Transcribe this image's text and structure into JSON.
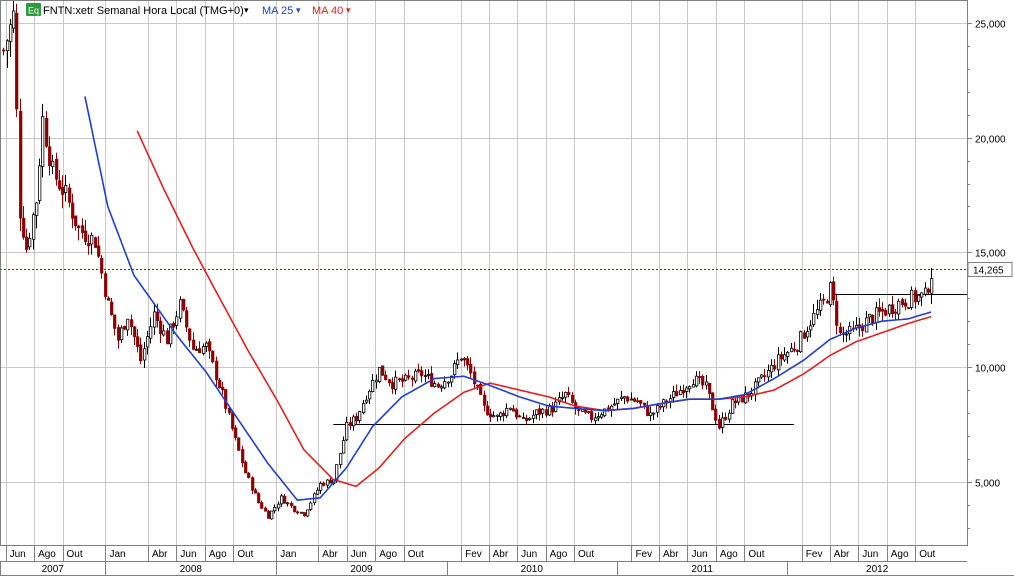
{
  "header": {
    "eq_badge": "Eq",
    "symbol_label": "FNTN:xetr Semanal Hora Local (TMG+0)",
    "ma25_label": "MA 25",
    "ma40_label": "MA 40",
    "dropdown_glyph": "▾"
  },
  "colors": {
    "price_up": "#000000",
    "price_down": "#8b0000",
    "ma25": "#1f3fd1",
    "ma40": "#e02020",
    "grid": "#c8c8c8",
    "highlight_line": "#cc0000",
    "eq_badge_bg": "#2e9b3a"
  },
  "chart_data": {
    "type": "candlestick",
    "title": "FNTN:xetr Semanal Hora Local (TMG+0)",
    "y_axis": {
      "side": "right",
      "ticks": [
        5000,
        10000,
        15000,
        20000,
        25000
      ],
      "tick_labels": [
        "5,000",
        "10,000",
        "15,000",
        "20,000",
        "25,000"
      ],
      "ylim": [
        2200,
        26000
      ]
    },
    "x_axis": {
      "xlim": [
        "2007-05-20",
        "2013-01-20"
      ],
      "month_ticks": [
        {
          "date": "2007-06-01",
          "label": "Jun"
        },
        {
          "date": "2007-08-01",
          "label": "Ago"
        },
        {
          "date": "2007-10-01",
          "label": "Out"
        },
        {
          "date": "2008-01-01",
          "label": "Jan"
        },
        {
          "date": "2008-04-01",
          "label": "Abr"
        },
        {
          "date": "2008-06-01",
          "label": "Jun"
        },
        {
          "date": "2008-08-01",
          "label": "Ago"
        },
        {
          "date": "2008-10-01",
          "label": "Out"
        },
        {
          "date": "2009-01-01",
          "label": "Jan"
        },
        {
          "date": "2009-04-01",
          "label": "Abr"
        },
        {
          "date": "2009-06-01",
          "label": "Jun"
        },
        {
          "date": "2009-08-01",
          "label": "Ago"
        },
        {
          "date": "2009-10-01",
          "label": "Out"
        },
        {
          "date": "2010-02-01",
          "label": "Fev"
        },
        {
          "date": "2010-04-01",
          "label": "Abr"
        },
        {
          "date": "2010-06-01",
          "label": "Jun"
        },
        {
          "date": "2010-08-01",
          "label": "Ago"
        },
        {
          "date": "2010-10-01",
          "label": "Out"
        },
        {
          "date": "2011-02-01",
          "label": "Fev"
        },
        {
          "date": "2011-04-01",
          "label": "Abr"
        },
        {
          "date": "2011-06-01",
          "label": "Jun"
        },
        {
          "date": "2011-08-01",
          "label": "Ago"
        },
        {
          "date": "2011-10-01",
          "label": "Out"
        },
        {
          "date": "2012-02-01",
          "label": "Fev"
        },
        {
          "date": "2012-04-01",
          "label": "Abr"
        },
        {
          "date": "2012-06-01",
          "label": "Jun"
        },
        {
          "date": "2012-08-01",
          "label": "Ago"
        },
        {
          "date": "2012-10-01",
          "label": "Out"
        }
      ],
      "year_labels": [
        {
          "label": "2007",
          "start": "2007-05-20",
          "end": "2008-01-01"
        },
        {
          "label": "2008",
          "start": "2008-01-01",
          "end": "2009-01-01"
        },
        {
          "label": "2009",
          "start": "2009-01-01",
          "end": "2010-01-01"
        },
        {
          "label": "2010",
          "start": "2010-01-01",
          "end": "2011-01-01"
        },
        {
          "label": "2011",
          "start": "2011-01-01",
          "end": "2012-01-01"
        },
        {
          "label": "2012",
          "start": "2012-01-01",
          "end": "2013-01-20"
        }
      ]
    },
    "price_anchors": [
      [
        "2007-05-27",
        23800
      ],
      [
        "2007-06-17",
        25300
      ],
      [
        "2007-07-01",
        16800
      ],
      [
        "2007-07-15",
        15200
      ],
      [
        "2007-08-05",
        17300
      ],
      [
        "2007-08-19",
        20800
      ],
      [
        "2007-09-09",
        18500
      ],
      [
        "2007-10-07",
        17500
      ],
      [
        "2007-11-04",
        16000
      ],
      [
        "2007-12-09",
        15500
      ],
      [
        "2008-01-06",
        12700
      ],
      [
        "2008-01-27",
        11200
      ],
      [
        "2008-02-17",
        12300
      ],
      [
        "2008-03-16",
        10300
      ],
      [
        "2008-04-13",
        12300
      ],
      [
        "2008-05-11",
        11200
      ],
      [
        "2008-06-08",
        12700
      ],
      [
        "2008-07-06",
        10800
      ],
      [
        "2008-08-03",
        10900
      ],
      [
        "2008-09-07",
        8800
      ],
      [
        "2008-10-05",
        6800
      ],
      [
        "2008-10-26",
        5400
      ],
      [
        "2008-11-23",
        4100
      ],
      [
        "2008-12-14",
        3500
      ],
      [
        "2009-01-11",
        4300
      ],
      [
        "2009-02-08",
        3800
      ],
      [
        "2009-03-01",
        3600
      ],
      [
        "2009-04-05",
        4900
      ],
      [
        "2009-05-03",
        5100
      ],
      [
        "2009-05-31",
        7400
      ],
      [
        "2009-06-21",
        7800
      ],
      [
        "2009-07-12",
        8800
      ],
      [
        "2009-08-09",
        9900
      ],
      [
        "2009-09-06",
        9300
      ],
      [
        "2009-10-04",
        9400
      ],
      [
        "2009-11-08",
        9700
      ],
      [
        "2009-12-13",
        9200
      ],
      [
        "2010-01-10",
        9700
      ],
      [
        "2010-01-31",
        10500
      ],
      [
        "2010-02-21",
        9700
      ],
      [
        "2010-03-21",
        8200
      ],
      [
        "2010-04-18",
        7800
      ],
      [
        "2010-05-16",
        8300
      ],
      [
        "2010-06-13",
        7600
      ],
      [
        "2010-07-11",
        8000
      ],
      [
        "2010-08-15",
        8200
      ],
      [
        "2010-09-12",
        8800
      ],
      [
        "2010-10-10",
        8000
      ],
      [
        "2010-11-07",
        7800
      ],
      [
        "2010-12-12",
        8200
      ],
      [
        "2011-01-16",
        8700
      ],
      [
        "2011-02-13",
        8500
      ],
      [
        "2011-03-13",
        7900
      ],
      [
        "2011-04-10",
        8400
      ],
      [
        "2011-05-15",
        9000
      ],
      [
        "2011-06-12",
        9500
      ],
      [
        "2011-07-10",
        9100
      ],
      [
        "2011-08-07",
        7400
      ],
      [
        "2011-09-04",
        8400
      ],
      [
        "2011-10-09",
        8800
      ],
      [
        "2011-11-13",
        9600
      ],
      [
        "2011-12-11",
        10300
      ],
      [
        "2012-01-22",
        11000
      ],
      [
        "2012-02-19",
        12000
      ],
      [
        "2012-03-18",
        12800
      ],
      [
        "2012-04-01",
        13400
      ],
      [
        "2012-04-22",
        11400
      ],
      [
        "2012-05-20",
        11500
      ],
      [
        "2012-06-24",
        12100
      ],
      [
        "2012-07-22",
        12400
      ],
      [
        "2012-08-26",
        12800
      ],
      [
        "2012-09-23",
        13000
      ],
      [
        "2012-10-21",
        13100
      ],
      [
        "2012-11-04",
        14100
      ]
    ],
    "ma25_anchors": [
      [
        "2007-11-18",
        21800
      ],
      [
        "2008-01-06",
        17000
      ],
      [
        "2008-03-02",
        14000
      ],
      [
        "2008-04-13",
        12800
      ],
      [
        "2008-06-01",
        11400
      ],
      [
        "2008-08-03",
        9800
      ],
      [
        "2008-10-05",
        7900
      ],
      [
        "2008-12-14",
        5800
      ],
      [
        "2009-02-15",
        4200
      ],
      [
        "2009-04-05",
        4300
      ],
      [
        "2009-05-31",
        5600
      ],
      [
        "2009-07-26",
        7400
      ],
      [
        "2009-09-27",
        8700
      ],
      [
        "2009-12-06",
        9500
      ],
      [
        "2010-02-07",
        9600
      ],
      [
        "2010-04-04",
        9200
      ],
      [
        "2010-06-06",
        8700
      ],
      [
        "2010-08-08",
        8300
      ],
      [
        "2010-10-03",
        8200
      ],
      [
        "2010-12-05",
        8100
      ],
      [
        "2011-02-06",
        8200
      ],
      [
        "2011-04-03",
        8400
      ],
      [
        "2011-06-05",
        8600
      ],
      [
        "2011-08-07",
        8600
      ],
      [
        "2011-10-02",
        8800
      ],
      [
        "2011-12-04",
        9500
      ],
      [
        "2012-02-05",
        10300
      ],
      [
        "2012-04-01",
        11200
      ],
      [
        "2012-05-27",
        11700
      ],
      [
        "2012-07-22",
        12000
      ],
      [
        "2012-09-16",
        12100
      ],
      [
        "2012-11-04",
        12400
      ]
    ],
    "ma40_anchors": [
      [
        "2008-03-09",
        20300
      ],
      [
        "2008-05-04",
        17800
      ],
      [
        "2008-07-06",
        15200
      ],
      [
        "2008-09-07",
        12800
      ],
      [
        "2008-11-02",
        10700
      ],
      [
        "2009-01-04",
        8500
      ],
      [
        "2009-03-01",
        6400
      ],
      [
        "2009-05-03",
        5100
      ],
      [
        "2009-06-21",
        4800
      ],
      [
        "2009-08-09",
        5600
      ],
      [
        "2009-10-04",
        6900
      ],
      [
        "2009-12-06",
        8000
      ],
      [
        "2010-02-07",
        8900
      ],
      [
        "2010-04-04",
        9300
      ],
      [
        "2010-06-06",
        9000
      ],
      [
        "2010-08-08",
        8700
      ],
      [
        "2010-10-03",
        8300
      ],
      [
        "2010-12-05",
        8100
      ],
      [
        "2011-02-06",
        8200
      ],
      [
        "2011-04-03",
        8400
      ],
      [
        "2011-06-05",
        8600
      ],
      [
        "2011-08-07",
        8600
      ],
      [
        "2011-10-02",
        8700
      ],
      [
        "2011-12-04",
        9000
      ],
      [
        "2012-02-05",
        9700
      ],
      [
        "2012-04-01",
        10500
      ],
      [
        "2012-05-27",
        11100
      ],
      [
        "2012-07-22",
        11500
      ],
      [
        "2012-09-16",
        11900
      ],
      [
        "2012-11-04",
        12200
      ]
    ],
    "horizontal_levels": [
      {
        "value": 14265,
        "style": "dotted",
        "color": "#cc0000",
        "label": "14,265"
      },
      {
        "value": 7500,
        "style": "solid",
        "color": "#000000",
        "from": "2009-05-03",
        "to": "2012-01-15"
      },
      {
        "value": 13200,
        "style": "solid",
        "color": "#000000",
        "from": "2012-04-01",
        "to": "2013-01-20"
      }
    ]
  }
}
